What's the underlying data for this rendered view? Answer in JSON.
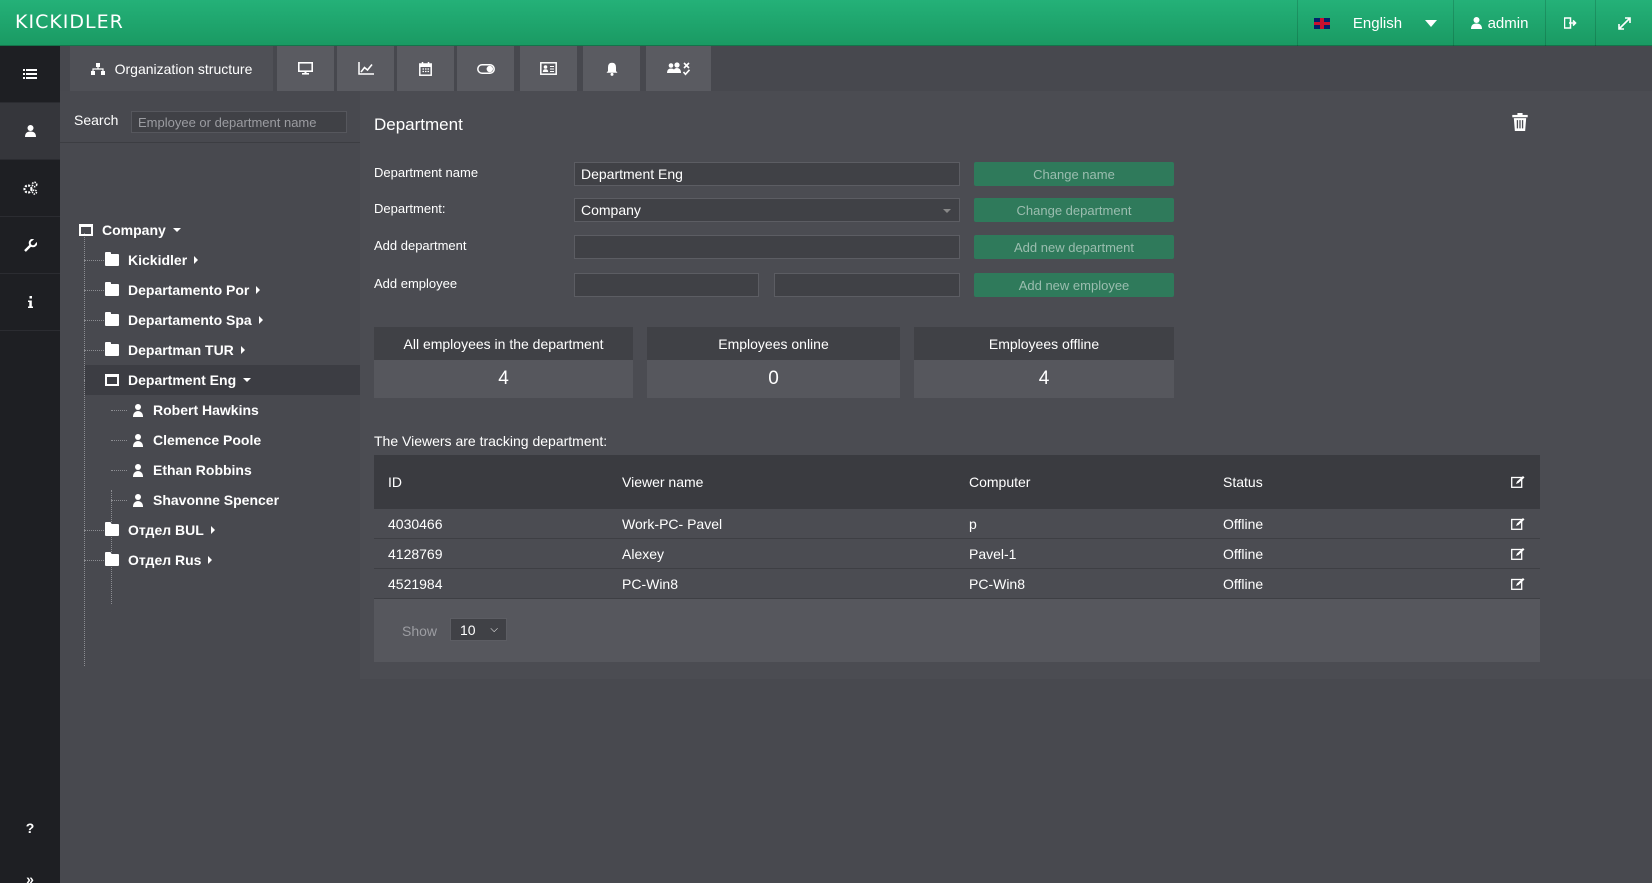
{
  "brand": {
    "logo_text": "KICKIDLER"
  },
  "topbar": {
    "language": "English",
    "user": "admin"
  },
  "tabs": [
    {
      "label": "Organization structure",
      "icon": "sitemap-icon"
    },
    {
      "label": "",
      "icon": "monitor-icon"
    },
    {
      "label": "",
      "icon": "line-chart-icon"
    },
    {
      "label": "",
      "icon": "calendar-icon"
    },
    {
      "label": "",
      "icon": "toggle-icon"
    },
    {
      "label": "",
      "icon": "id-card-icon"
    },
    {
      "label": "",
      "icon": "bell-icon"
    },
    {
      "label": "",
      "icon": "users-check-icon"
    }
  ],
  "search": {
    "label": "Search",
    "placeholder": "Employee or department name"
  },
  "tree": {
    "root": "Company",
    "departments": [
      "Kickidler",
      "Departamento Por",
      "Departamento Spa",
      "Departman TUR",
      "Department Eng",
      "Отдел BUL",
      "Отдел Rus"
    ],
    "selected": "Department Eng",
    "employees": [
      "Robert Hawkins",
      "Clemence Poole",
      "Ethan Robbins",
      "Shavonne Spencer"
    ]
  },
  "department": {
    "title": "Department",
    "name_label": "Department name",
    "name_value": "Department Eng",
    "change_name": "Change name",
    "parent_label": "Department:",
    "parent_value": "Company",
    "change_department": "Change department",
    "add_dept_label": "Add department",
    "add_dept_button": "Add new department",
    "add_emp_label": "Add employee",
    "add_emp_button": "Add new employee"
  },
  "stats": [
    {
      "label": "All employees in the department",
      "value": "4"
    },
    {
      "label": "Employees online",
      "value": "0"
    },
    {
      "label": "Employees offline",
      "value": "4"
    }
  ],
  "viewers": {
    "title": "The Viewers are tracking department:",
    "columns": [
      "ID",
      "Viewer name",
      "Computer",
      "Status"
    ],
    "rows": [
      {
        "id": "4030466",
        "name": "Work-PC- Pavel",
        "computer": "p",
        "status": "Offline"
      },
      {
        "id": "4128769",
        "name": "Alexey",
        "computer": "Pavel-1",
        "status": "Offline"
      },
      {
        "id": "4521984",
        "name": "PC-Win8",
        "computer": "PC-Win8",
        "status": "Offline"
      }
    ],
    "show_label": "Show",
    "page_size": "10"
  },
  "sidebar": {
    "help": "?",
    "expand": "»"
  }
}
